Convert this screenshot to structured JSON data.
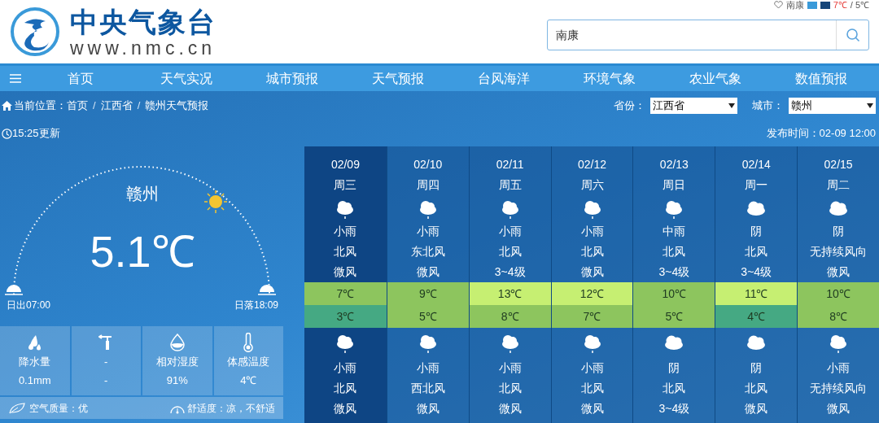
{
  "header": {
    "logo_title": "中央气象台",
    "logo_url": "www.nmc.cn",
    "favorite": {
      "city": "南康",
      "high": "7℃",
      "low": "/ 5℃"
    },
    "search": {
      "value": "南康"
    }
  },
  "nav": [
    "首页",
    "天气实况",
    "城市预报",
    "天气预报",
    "台风海洋",
    "环境气象",
    "农业气象",
    "数值预报"
  ],
  "breadcrumb": {
    "label": "当前位置：",
    "items": [
      {
        "kind": "link",
        "text": "首页"
      },
      {
        "kind": "separator",
        "text": "/"
      },
      {
        "kind": "link",
        "text": "江西省"
      },
      {
        "kind": "separator",
        "text": "/"
      },
      {
        "kind": "link",
        "text": "赣州天气预报"
      }
    ]
  },
  "province": {
    "label": "省份：",
    "value": "江西省"
  },
  "city_select": {
    "label": "城市：",
    "value": "赣州"
  },
  "updated": "15:25更新",
  "published": "发布时间：02-09 12:00",
  "current": {
    "city": "赣州",
    "temperature": "5.1℃",
    "sunrise": "日出07:00",
    "sunset": "日落18:09",
    "stats": [
      {
        "kind": "rain",
        "label": "降水量",
        "value": "0.1mm"
      },
      {
        "kind": "wind",
        "label": "-",
        "value": "-"
      },
      {
        "kind": "humidity",
        "label": "相对湿度",
        "value": "91%"
      },
      {
        "kind": "feels",
        "label": "体感温度",
        "value": "4℃"
      }
    ],
    "air_quality": "空气质量：优",
    "comfort": "舒适度：凉，不舒适"
  },
  "forecast": [
    {
      "date": "02/09",
      "weekday": "周三",
      "selected": true,
      "day": {
        "kind": "rain",
        "weather": "小雨",
        "wind_direction": "北风",
        "wind_level": "微风"
      },
      "high": {
        "text": "7℃",
        "color": "#8dc55e"
      },
      "low": {
        "text": "3℃",
        "color": "#45a983"
      },
      "night": {
        "kind": "rain",
        "weather": "小雨",
        "wind_direction": "北风",
        "wind_level": "微风"
      }
    },
    {
      "date": "02/10",
      "weekday": "周四",
      "selected": false,
      "day": {
        "kind": "rain",
        "weather": "小雨",
        "wind_direction": "东北风",
        "wind_level": "微风"
      },
      "high": {
        "text": "9℃",
        "color": "#8dc55e"
      },
      "low": {
        "text": "5℃",
        "color": "#8dc55e"
      },
      "night": {
        "kind": "rain",
        "weather": "小雨",
        "wind_direction": "西北风",
        "wind_level": "微风"
      }
    },
    {
      "date": "02/11",
      "weekday": "周五",
      "selected": false,
      "day": {
        "kind": "rain",
        "weather": "小雨",
        "wind_direction": "北风",
        "wind_level": "3~4级"
      },
      "high": {
        "text": "13℃",
        "color": "#c6ef72"
      },
      "low": {
        "text": "8℃",
        "color": "#8dc55e"
      },
      "night": {
        "kind": "rain",
        "weather": "小雨",
        "wind_direction": "北风",
        "wind_level": "微风"
      }
    },
    {
      "date": "02/12",
      "weekday": "周六",
      "selected": false,
      "day": {
        "kind": "rain",
        "weather": "小雨",
        "wind_direction": "北风",
        "wind_level": "微风"
      },
      "high": {
        "text": "12℃",
        "color": "#c6ef72"
      },
      "low": {
        "text": "7℃",
        "color": "#8dc55e"
      },
      "night": {
        "kind": "rain",
        "weather": "小雨",
        "wind_direction": "北风",
        "wind_level": "微风"
      }
    },
    {
      "date": "02/13",
      "weekday": "周日",
      "selected": false,
      "day": {
        "kind": "rain",
        "weather": "中雨",
        "wind_direction": "北风",
        "wind_level": "3~4级"
      },
      "high": {
        "text": "10℃",
        "color": "#8dc55e"
      },
      "low": {
        "text": "5℃",
        "color": "#8dc55e"
      },
      "night": {
        "kind": "cloudy",
        "weather": "阴",
        "wind_direction": "北风",
        "wind_level": "3~4级"
      }
    },
    {
      "date": "02/14",
      "weekday": "周一",
      "selected": false,
      "day": {
        "kind": "cloudy",
        "weather": "阴",
        "wind_direction": "北风",
        "wind_level": "3~4级"
      },
      "high": {
        "text": "11℃",
        "color": "#c6ef72"
      },
      "low": {
        "text": "4℃",
        "color": "#45a983"
      },
      "night": {
        "kind": "cloudy",
        "weather": "阴",
        "wind_direction": "北风",
        "wind_level": "微风"
      }
    },
    {
      "date": "02/15",
      "weekday": "周二",
      "selected": false,
      "day": {
        "kind": "cloudy",
        "weather": "阴",
        "wind_direction": "无持续风向",
        "wind_level": "微风"
      },
      "high": {
        "text": "10℃",
        "color": "#8dc55e"
      },
      "low": {
        "text": "8℃",
        "color": "#8dc55e"
      },
      "night": {
        "kind": "rain",
        "weather": "小雨",
        "wind_direction": "无持续风向",
        "wind_level": "微风"
      }
    }
  ]
}
